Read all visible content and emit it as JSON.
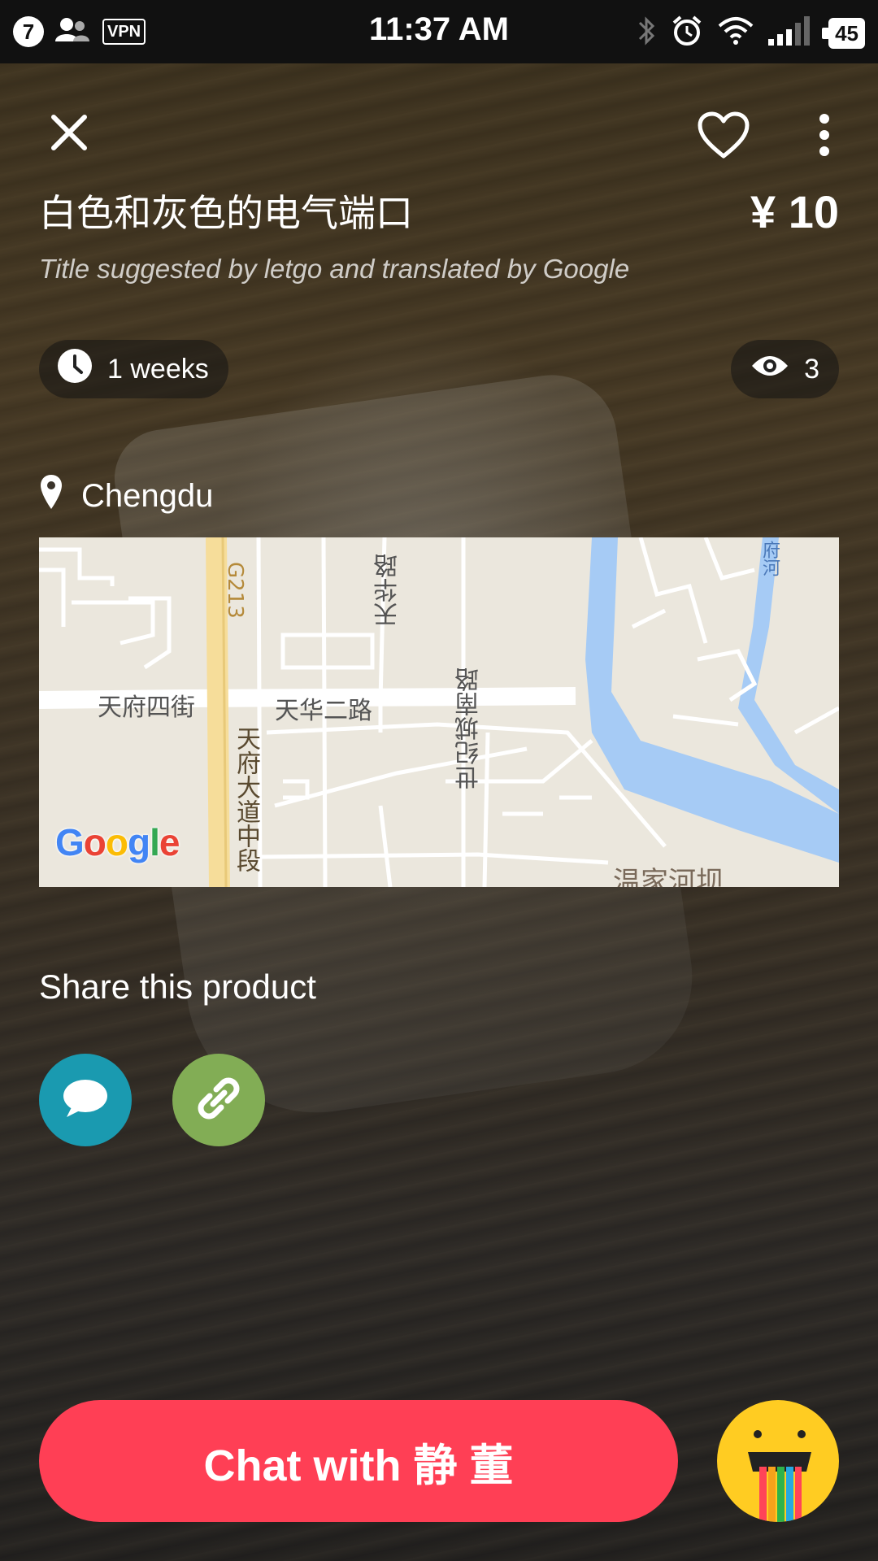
{
  "status_bar": {
    "notification_count": "7",
    "vpn_label": "VPN",
    "time": "11:37 AM",
    "battery": "45"
  },
  "product": {
    "title": "白色和灰色的电气端口",
    "price": "¥ 10",
    "title_note": "Title suggested by letgo and translated by Google",
    "age": "1 weeks",
    "views": "3",
    "location": "Chengdu"
  },
  "map": {
    "labels": {
      "street_1": "天府四街",
      "street_2": "天华二路",
      "street_3": "天华路",
      "street_4": "世纪城南路",
      "highway": "G213",
      "avenue": "天府大道中段",
      "district": "温家河坝",
      "river": "府河"
    },
    "logo_text": "Google",
    "colors": {
      "land": "#ebe7dd",
      "road": "#ffffff",
      "water": "#a6cbf5",
      "highway": "#f6dd9a"
    }
  },
  "share": {
    "title": "Share this product",
    "buttons": [
      "message-icon",
      "link-icon"
    ]
  },
  "chat": {
    "label": "Chat with 静 董"
  },
  "colors": {
    "accent": "#ff3f55",
    "share_message": "#1a9ab0",
    "share_link": "#82ad55",
    "mascot": "#ffcc22"
  }
}
